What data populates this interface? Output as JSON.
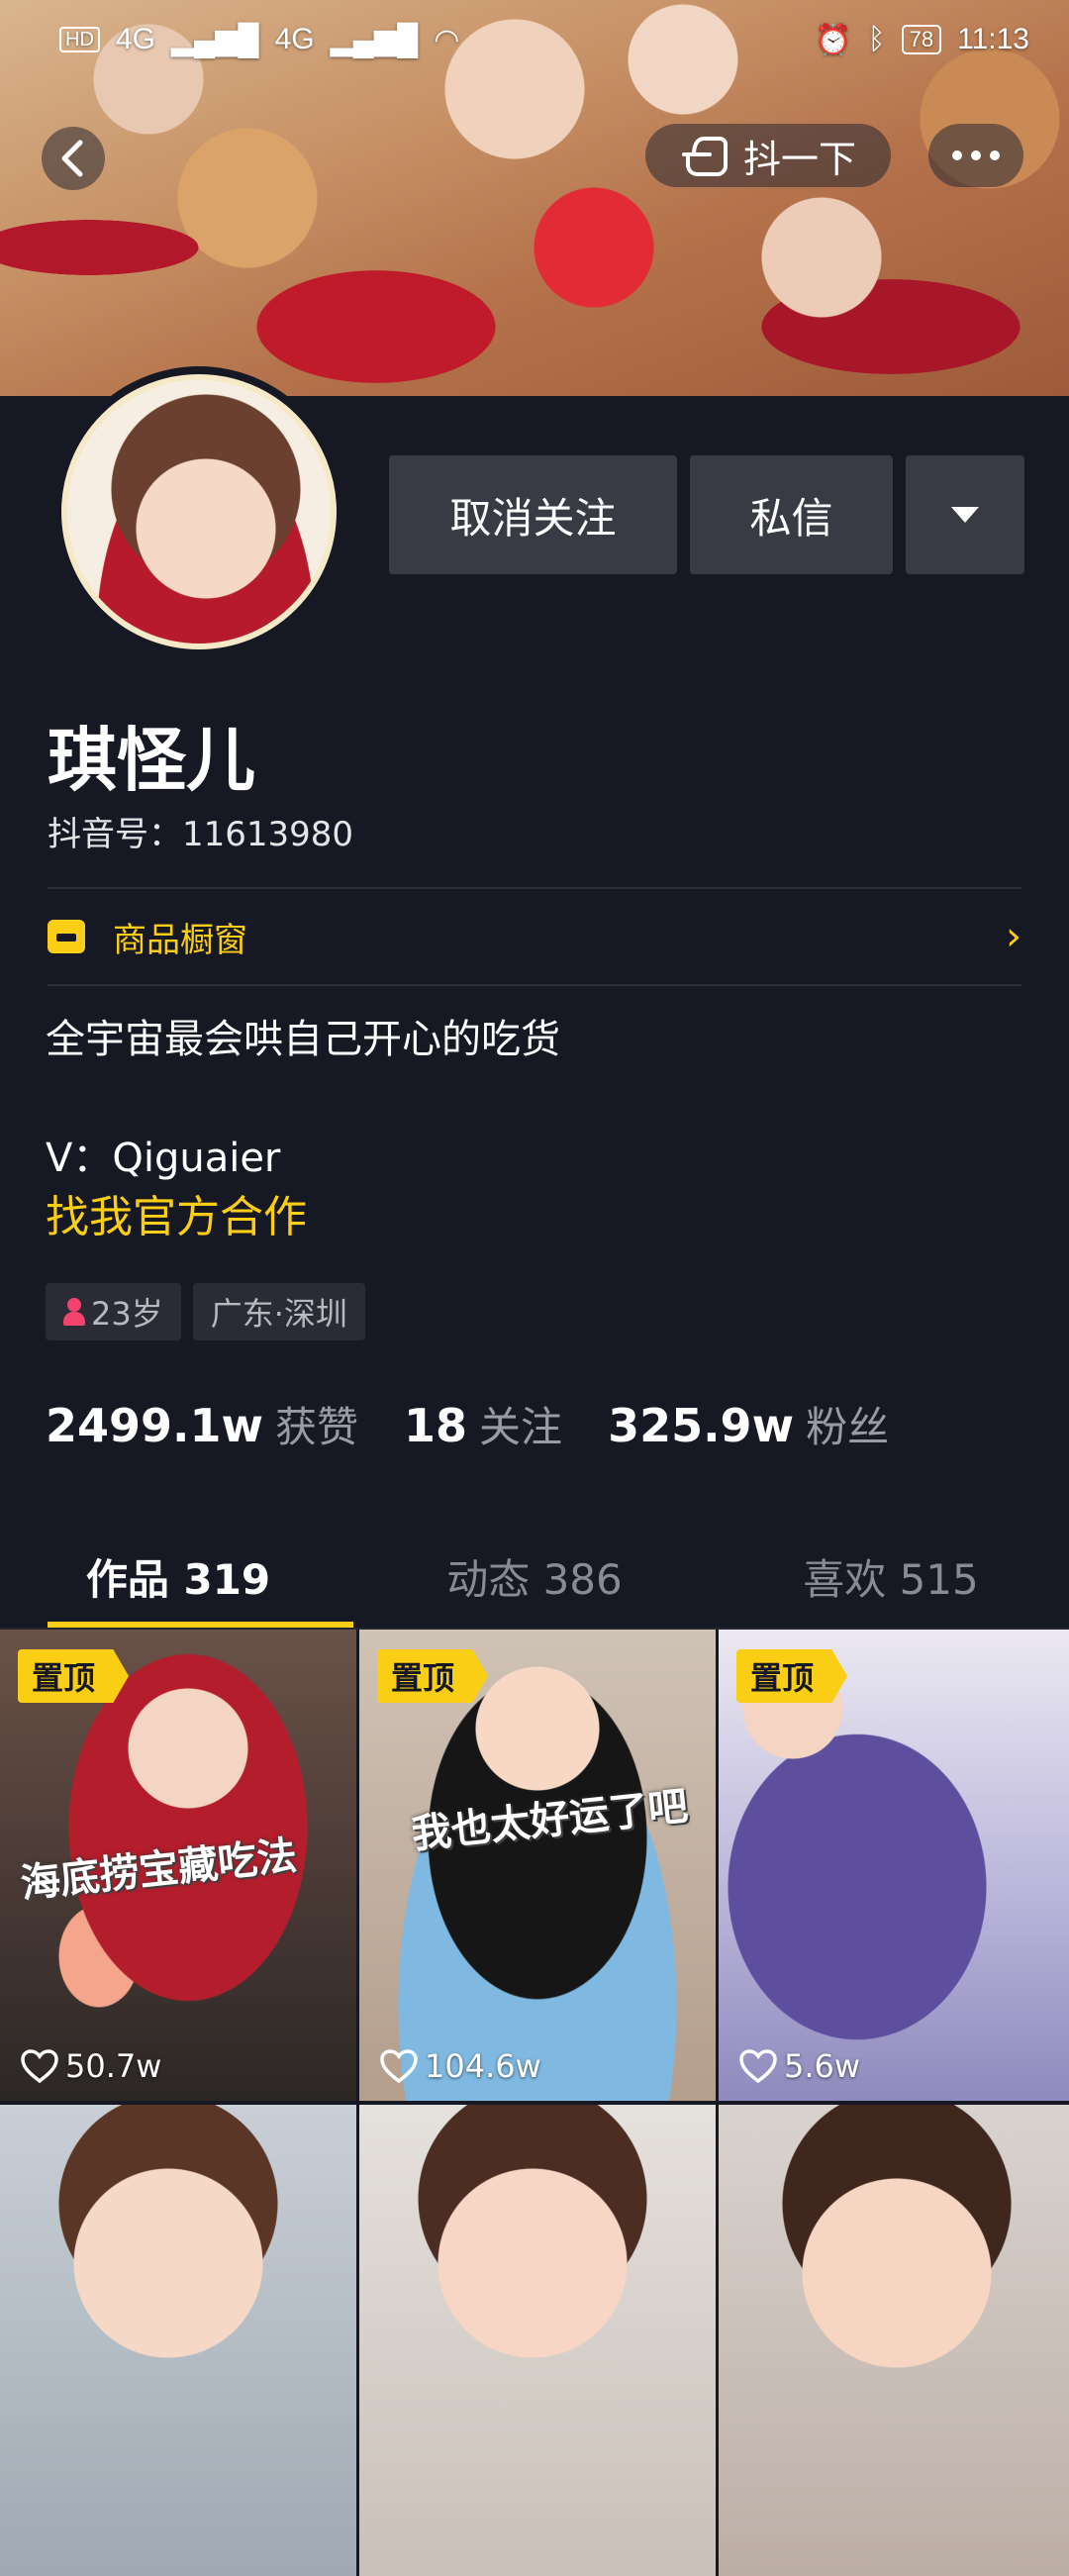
{
  "status_bar": {
    "left_indicators": [
      "HD",
      "4G",
      "4G"
    ],
    "battery": "78",
    "time": "11:13"
  },
  "header": {
    "shake_label": "抖一下"
  },
  "actions": {
    "unfollow_label": "取消关注",
    "message_label": "私信"
  },
  "profile": {
    "name": "琪怪儿",
    "douyin_id": "抖音号：11613980",
    "shop_label": "商品橱窗",
    "bio": "全宇宙最会哄自己开心的吃货",
    "wechat": "V：Qiguaier",
    "cooperation": "找我官方合作",
    "tags": {
      "age": "23岁",
      "location": "广东·深圳"
    }
  },
  "stats": [
    {
      "value": "2499.1w",
      "label": "获赞"
    },
    {
      "value": "18",
      "label": "关注"
    },
    {
      "value": "325.9w",
      "label": "粉丝"
    }
  ],
  "tabs": [
    {
      "label": "作品 319",
      "active": true
    },
    {
      "label": "动态 386",
      "active": false
    },
    {
      "label": "喜欢 515",
      "active": false
    }
  ],
  "videos": [
    {
      "pinned": "置顶",
      "caption": "海底捞宝藏吃法",
      "likes": "50.7w"
    },
    {
      "pinned": "置顶",
      "caption": "我也太好运了吧",
      "likes": "104.6w"
    },
    {
      "pinned": "置顶",
      "caption": "",
      "likes": "5.6w"
    }
  ],
  "colors": {
    "background": "#161823",
    "accent": "#face15",
    "button": "#393b44"
  }
}
